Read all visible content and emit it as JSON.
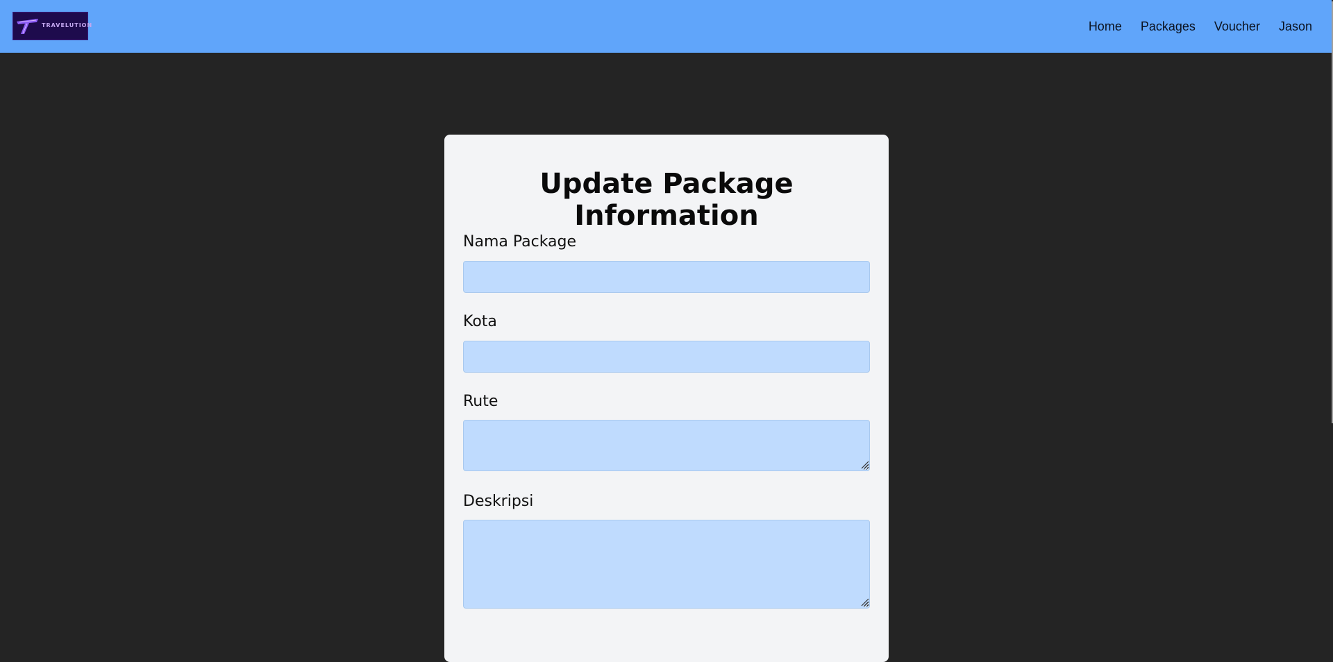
{
  "brand": {
    "name": "TRAVELUTION",
    "colors": {
      "navbar": "#60a5fa",
      "logo_bg": "#1e0b4d",
      "logo_accent": "#8b5cf6"
    }
  },
  "nav": {
    "links": [
      {
        "label": "Home"
      },
      {
        "label": "Packages"
      },
      {
        "label": "Voucher"
      },
      {
        "label": "Jason"
      }
    ]
  },
  "form": {
    "title": "Update Package Information",
    "fields": {
      "nama_package": {
        "label": "Nama Package",
        "value": ""
      },
      "kota": {
        "label": "Kota",
        "value": ""
      },
      "rute": {
        "label": "Rute",
        "value": ""
      },
      "deskripsi": {
        "label": "Deskripsi",
        "value": ""
      }
    },
    "colors": {
      "card": "#f3f4f6",
      "input": "#bfdbfe",
      "page": "#242424"
    }
  }
}
